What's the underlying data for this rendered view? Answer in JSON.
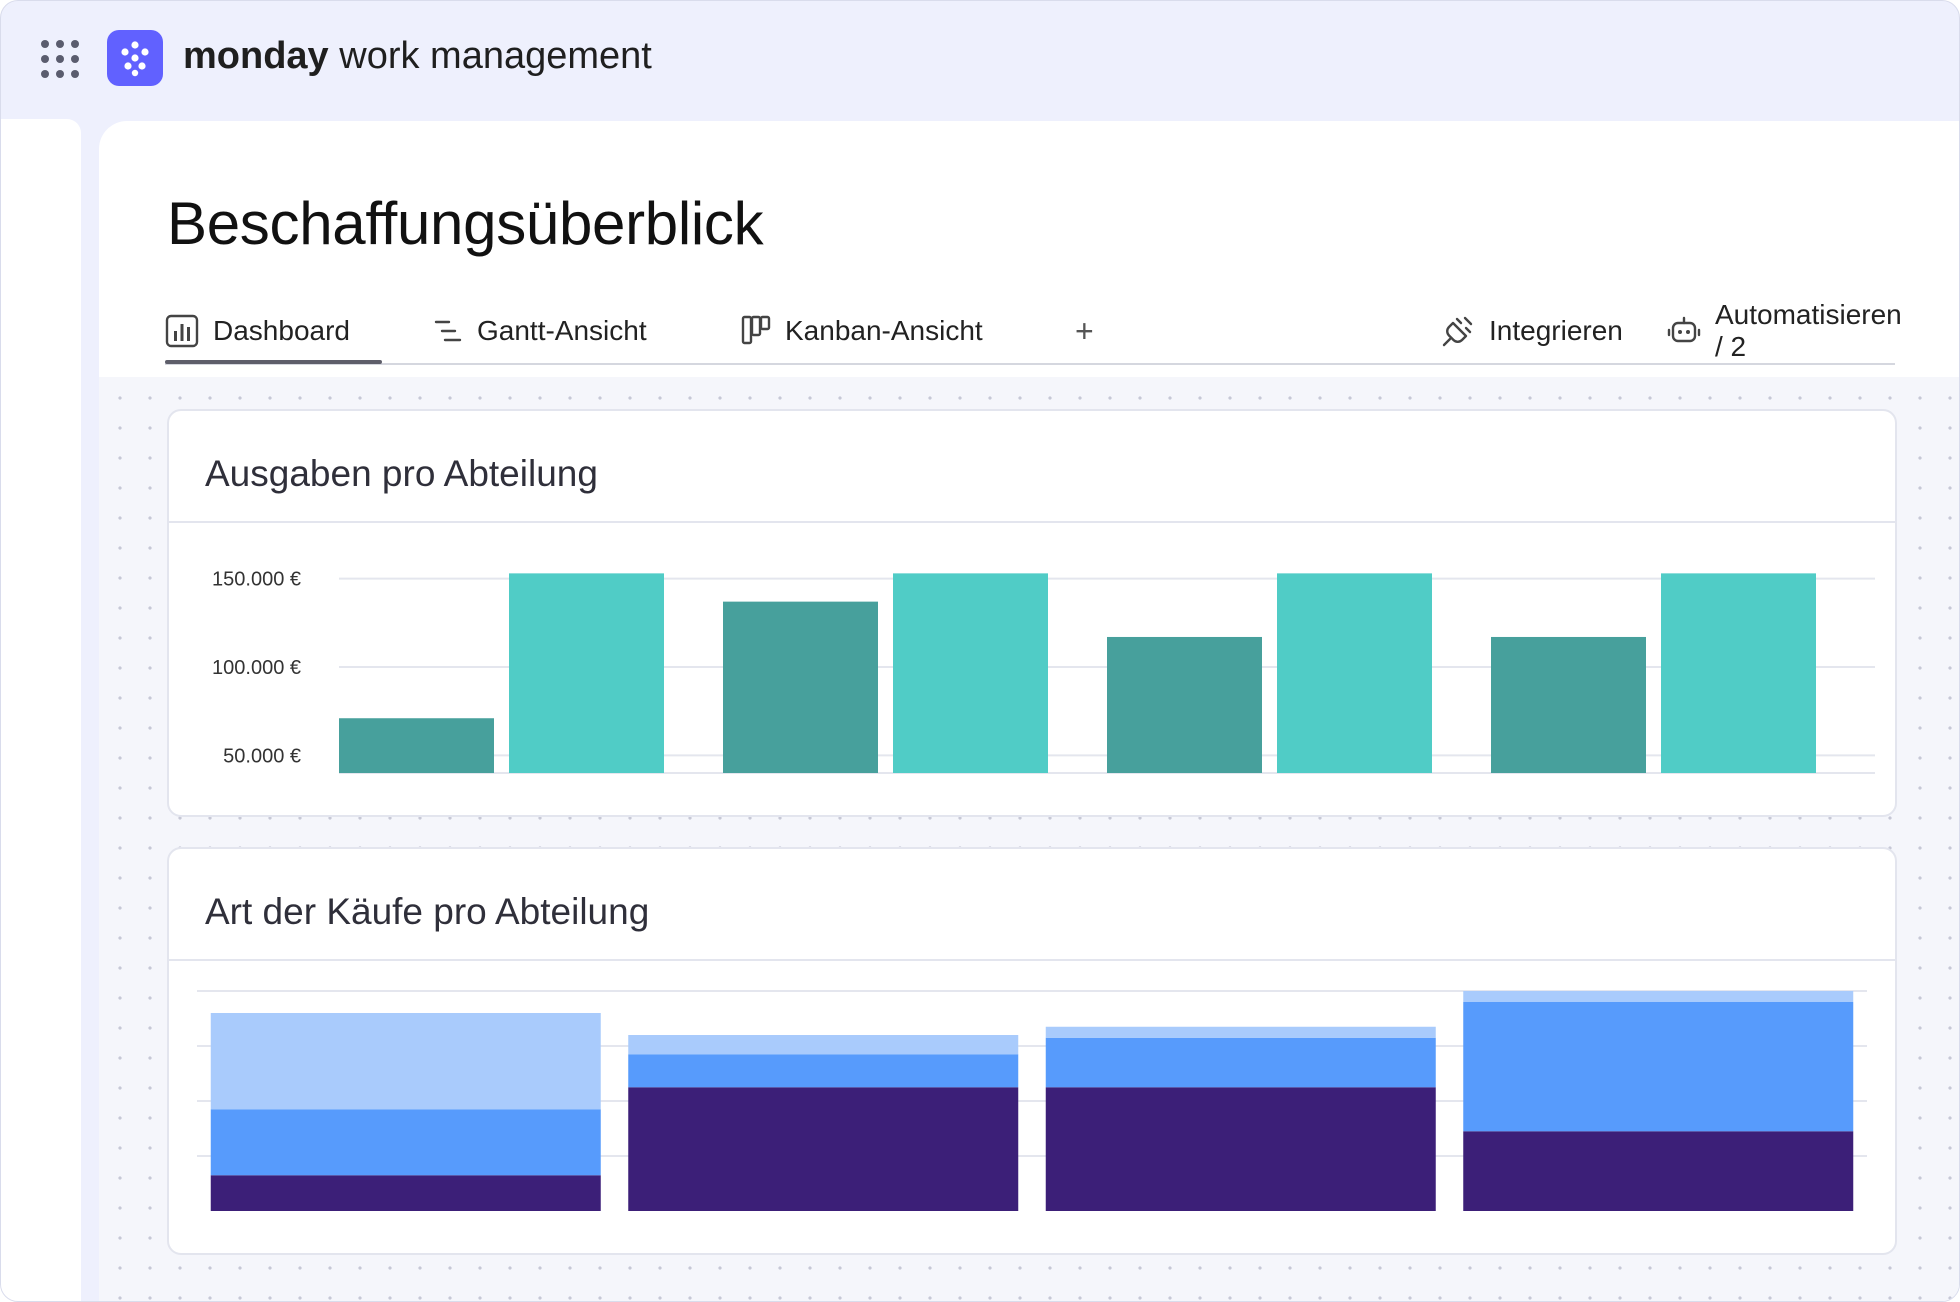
{
  "app": {
    "brand_bold": "monday",
    "brand_rest": " work management",
    "apps_icon": "apps-grid-icon",
    "logo_icon": "monday-logo-icon",
    "accent_color": "#6161ff"
  },
  "page": {
    "title": "Beschaffungsüberblick"
  },
  "tabs": [
    {
      "label": "Dashboard",
      "icon": "dashboard-chart-icon",
      "active": true
    },
    {
      "label": "Gantt-Ansicht",
      "icon": "gantt-icon",
      "active": false
    },
    {
      "label": "Kanban-Ansicht",
      "icon": "kanban-icon",
      "active": false
    },
    {
      "label": "+",
      "icon": "add-view-icon",
      "active": false
    }
  ],
  "actions": [
    {
      "label": "Integrieren",
      "icon": "integrate-plug-icon"
    },
    {
      "label": "Automatisieren / 2",
      "icon": "robot-automation-icon"
    }
  ],
  "widgets": [
    {
      "title": "Ausgaben pro Abteilung"
    },
    {
      "title": "Art der Käufe pro Abteilung"
    }
  ],
  "chart_data": [
    {
      "type": "bar",
      "title": "Ausgaben pro Abteilung",
      "categories": [
        "",
        "",
        "",
        ""
      ],
      "series": [
        {
          "values": [
            71000,
            137000,
            117000,
            117000
          ],
          "color": "#47a09c"
        },
        {
          "values": [
            153000,
            153000,
            153000,
            153000
          ],
          "color": "#50ccc6"
        }
      ],
      "yticks": [
        "150.000 €",
        "100.000 €",
        "50.000 €"
      ],
      "ylim": [
        40000,
        160000
      ],
      "grid": true
    },
    {
      "type": "bar",
      "stacked": true,
      "title": "Art der Käufe pro Abteilung",
      "categories": [
        "",
        "",
        "",
        ""
      ],
      "series": [
        {
          "values": [
            13,
            45,
            45,
            29
          ],
          "color": "#3c1f78"
        },
        {
          "values": [
            24,
            12,
            18,
            47
          ],
          "color": "#579bfc"
        },
        {
          "values": [
            35,
            7,
            4,
            4
          ],
          "color": "#a9cbfc"
        }
      ],
      "ylim": [
        0,
        80
      ],
      "grid": true
    }
  ]
}
